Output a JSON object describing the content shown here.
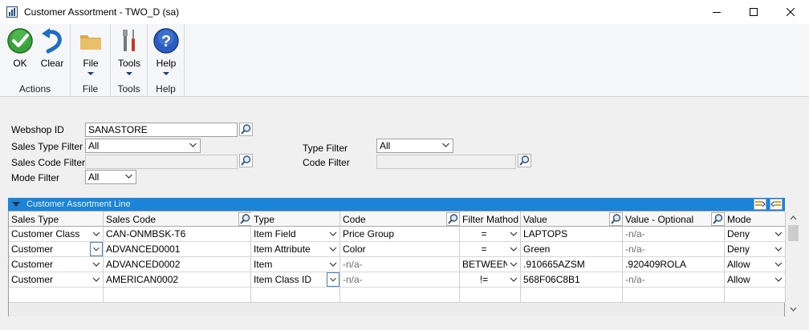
{
  "window": {
    "title": "Customer Assortment  -  TWO_D (sa)"
  },
  "ribbon": {
    "groups": [
      {
        "name": "Actions",
        "buttons": [
          {
            "label": "OK",
            "icon": "ok-check-icon"
          },
          {
            "label": "Clear",
            "icon": "clear-undo-icon"
          }
        ]
      },
      {
        "name": "File",
        "buttons": [
          {
            "label": "File",
            "icon": "folder-icon"
          }
        ]
      },
      {
        "name": "Tools",
        "buttons": [
          {
            "label": "Tools",
            "icon": "tools-icon"
          }
        ]
      },
      {
        "name": "Help",
        "buttons": [
          {
            "label": "Help",
            "icon": "help-icon"
          }
        ]
      }
    ]
  },
  "form": {
    "webshop_id": {
      "label": "Webshop ID",
      "value": "SANASTORE"
    },
    "sales_type_filter": {
      "label": "Sales Type Filter",
      "value": "All"
    },
    "sales_code_filter": {
      "label": "Sales Code Filter",
      "value": ""
    },
    "mode_filter": {
      "label": "Mode Filter",
      "value": "All"
    },
    "type_filter": {
      "label": "Type Filter",
      "value": "All"
    },
    "code_filter": {
      "label": "Code Filter",
      "value": ""
    }
  },
  "grid": {
    "title": "Customer Assortment Line",
    "columns": [
      "Sales Type",
      "Sales Code",
      "Type",
      "Code",
      "Filter Mathod",
      "Value",
      "Value - Optional",
      "Mode"
    ],
    "rows": [
      {
        "sales_type": "Customer Class",
        "sales_code": "CAN-ONMBSK-T6",
        "type": "Item Field",
        "code": "Price Group",
        "filter": "=",
        "value": "LAPTOPS",
        "value_optional": "-n/a-",
        "mode": "Deny"
      },
      {
        "sales_type": "Customer",
        "sales_code": "ADVANCED0001",
        "type": "Item Attribute",
        "code": "Color",
        "filter": "=",
        "value": "Green",
        "value_optional": "-n/a-",
        "mode": "Deny"
      },
      {
        "sales_type": "Customer",
        "sales_code": "ADVANCED0002",
        "type": "Item",
        "code": "-n/a-",
        "filter": "BETWEEN",
        "value": ".910665AZSM",
        "value_optional": ".920409ROLA",
        "mode": "Allow"
      },
      {
        "sales_type": "Customer",
        "sales_code": "AMERICAN0002",
        "type": "Item Class ID",
        "code": "-n/a-",
        "filter": "!=",
        "value": "568F06C8B1",
        "value_optional": "-n/a-",
        "mode": "Allow"
      }
    ]
  },
  "colors": {
    "grid_header": "#1b84d6",
    "ribbon_bg": "#f5f6f7",
    "window_bg": "#f0f0f0"
  }
}
